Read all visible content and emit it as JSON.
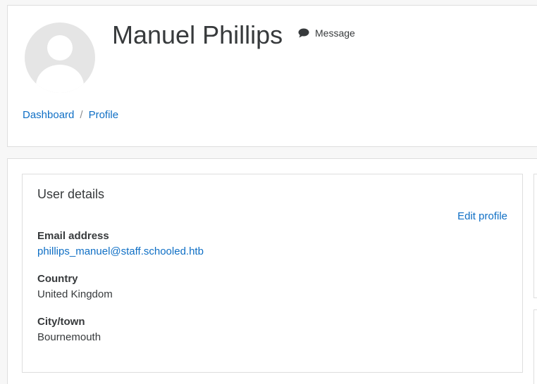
{
  "profile": {
    "name": "Manuel Phillips",
    "message_label": "Message"
  },
  "breadcrumb": {
    "items": [
      "Dashboard",
      "Profile"
    ],
    "separator": "/"
  },
  "user_details": {
    "title": "User details",
    "edit_label": "Edit profile",
    "email_label": "Email address",
    "email_value": "phillips_manuel@staff.schooled.htb",
    "country_label": "Country",
    "country_value": "United Kingdom",
    "city_label": "City/town",
    "city_value": "Bournemouth"
  },
  "icons": {
    "avatar": "default-user-avatar",
    "message": "comment-icon"
  },
  "colors": {
    "link": "#0f6fc5",
    "text": "#373a3c",
    "background": "#f7f7f7",
    "border": "#dedede"
  }
}
